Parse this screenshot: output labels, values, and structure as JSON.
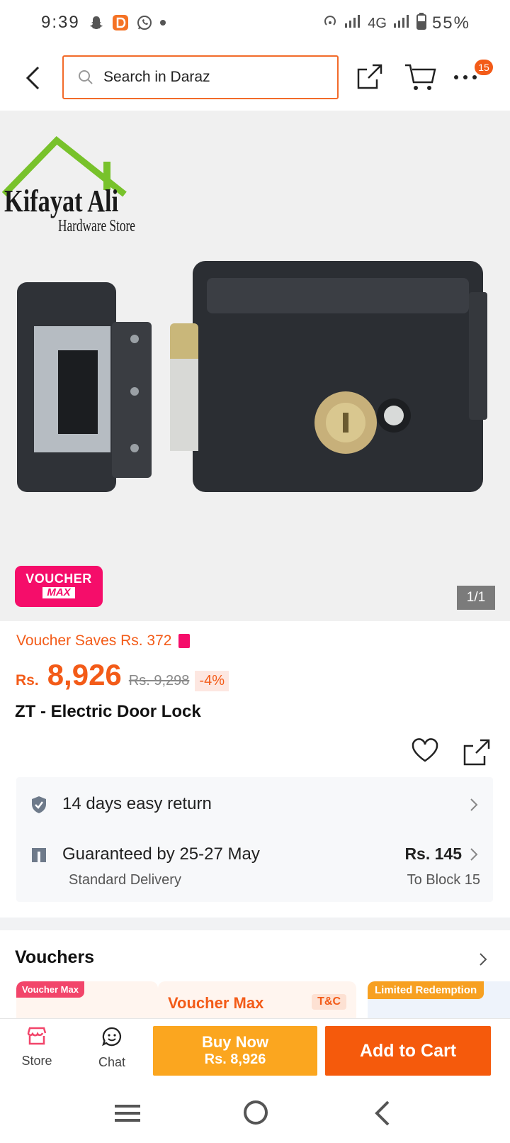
{
  "status_bar": {
    "time": "9:39",
    "network": "4G",
    "battery": "55%"
  },
  "header": {
    "search_placeholder": "Search in Daraz",
    "cart_badge": "15"
  },
  "gallery": {
    "logo_line1": "Kifayat Ali",
    "logo_line2": "Hardware Store",
    "voucher_badge_line1": "VOUCHER",
    "voucher_badge_line2": "MAX",
    "image_counter": "1/1"
  },
  "product": {
    "voucher_saves": "Voucher Saves Rs. 372",
    "currency": "Rs.",
    "price": "8,926",
    "old_price": "Rs. 9,298",
    "discount": "-4%",
    "title": "ZT - Electric Door Lock"
  },
  "delivery": {
    "return_text": "14 days easy return",
    "guarantee_text": "Guaranteed by 25-27 May",
    "standard_delivery": "Standard Delivery",
    "delivery_price": "Rs. 145",
    "delivery_to": "To Block 15"
  },
  "vouchers": {
    "title": "Vouchers",
    "card1_tag": "Voucher Max",
    "card2_title": "Voucher Max",
    "card2_tc": "T&C",
    "card3_tag": "Limited Redemption"
  },
  "action_bar": {
    "store_label": "Store",
    "chat_label": "Chat",
    "buy_now_line1": "Buy Now",
    "buy_now_line2": "Rs. 8,926",
    "add_to_cart": "Add to Cart"
  },
  "colors": {
    "accent": "#f35b18",
    "voucher_pink": "#f50d6a",
    "buy_now": "#fba61f",
    "add_to_cart": "#f55a0c"
  }
}
